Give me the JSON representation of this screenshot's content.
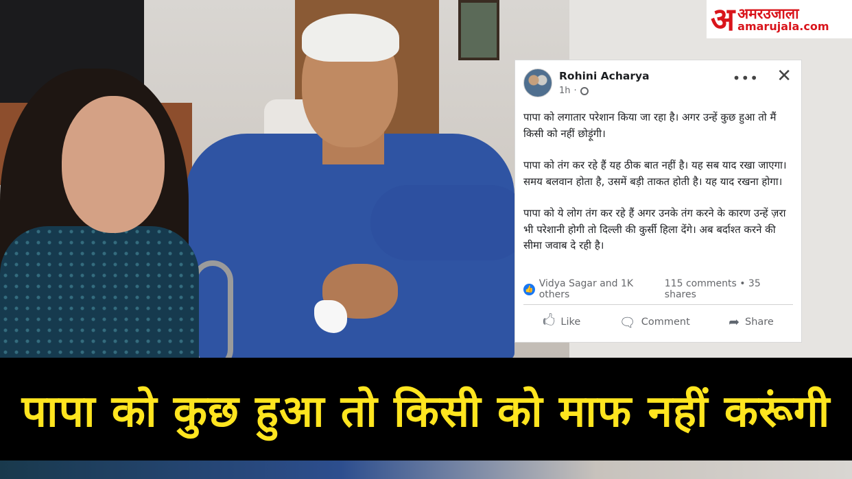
{
  "logo": {
    "mark": "अ",
    "name": "अमरउजाला",
    "domain": "amarujala.com"
  },
  "post": {
    "author": "Rohini Acharya",
    "time": "1h",
    "paragraphs": [
      "पापा को लगातार परेशान किया जा रहा है। अगर उन्हें कुछ हुआ तो मैं किसी को नहीं छोड़ूंगी।",
      "पापा को तंग कर रहे हैं यह ठीक बात नहीं है।  यह सब याद रखा जाएगा। समय बलवान होता है, उसमें बड़ी ताकत होती है। यह याद रखना होगा।",
      "पापा को ये लोग तंग कर रहे हैं अगर उनके तंग करने के कारण उन्हें ज़रा भी परेशानी होगी तो दिल्ली की कुर्सी हिला देंगे। अब बर्दाश्त करने की सीमा जवाब दे रही है।"
    ],
    "reactions": "Vidya Sagar and 1K others",
    "counts": "115 comments • 35 shares",
    "like_label": "Like",
    "comment_label": "Comment",
    "share_label": "Share"
  },
  "headline": "पापा को कुछ हुआ तो किसी को माफ नहीं करूंगी",
  "colors": {
    "headline_text": "#ffe51f",
    "headline_bg": "#000000",
    "logo_red": "#d9141b",
    "facebook_blue": "#1877f2"
  }
}
